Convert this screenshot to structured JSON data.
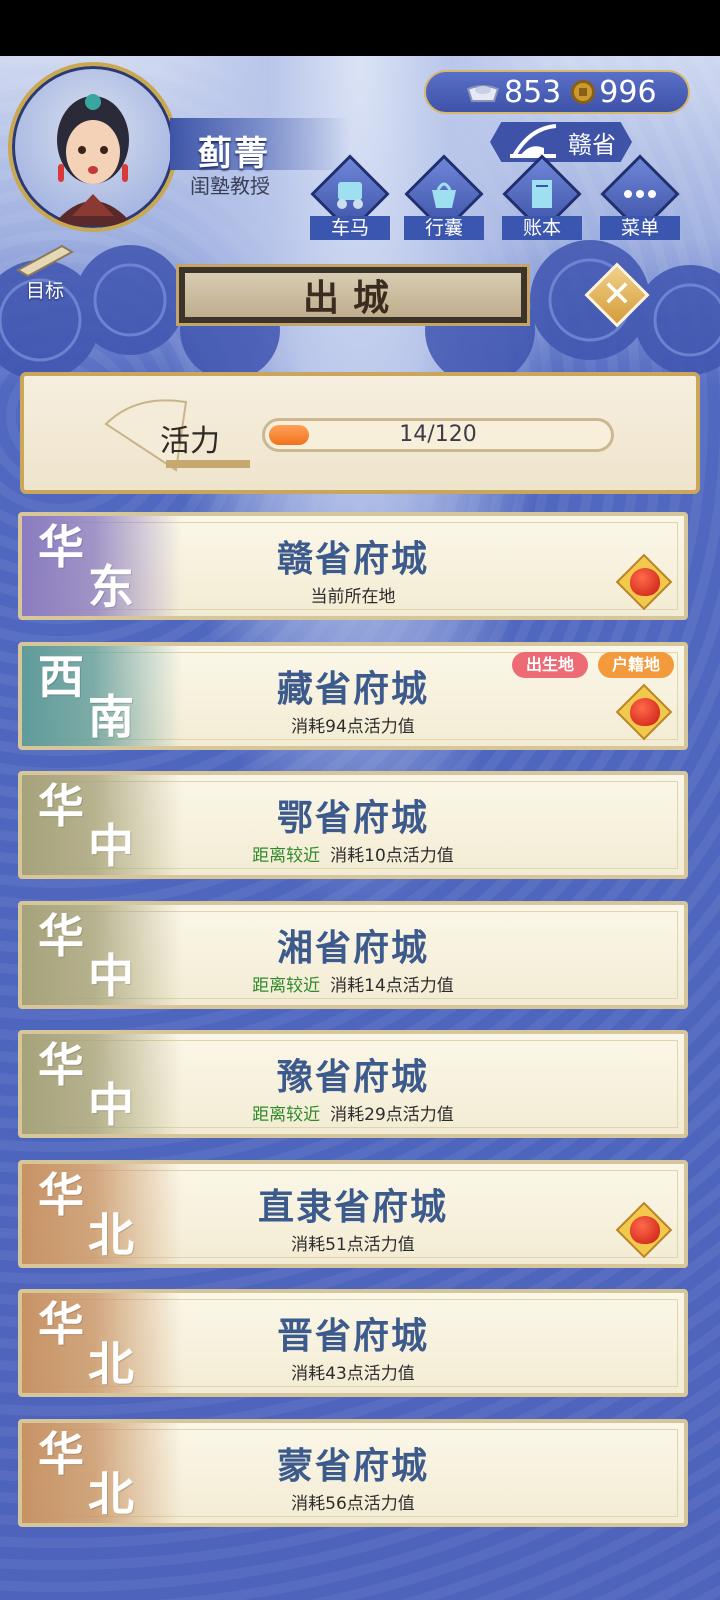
{
  "profile": {
    "name": "蓟菁",
    "title": "闺塾教授"
  },
  "currency": {
    "silver": "853",
    "copper": "996"
  },
  "location": {
    "label": "赣省"
  },
  "nav": [
    {
      "label": "车马",
      "icon": "carriage-icon"
    },
    {
      "label": "行囊",
      "icon": "bag-icon"
    },
    {
      "label": "账本",
      "icon": "ledger-icon"
    },
    {
      "label": "菜单",
      "icon": "menu-dots-icon"
    }
  ],
  "target": {
    "label": "目标"
  },
  "banner": {
    "title": "出城"
  },
  "stamina": {
    "label": "活力",
    "text": "14/120",
    "current": 14,
    "max": 120
  },
  "cities": [
    {
      "region": [
        "华",
        "东"
      ],
      "name": "赣省府城",
      "note": "",
      "sub": "当前所在地",
      "pouch": true,
      "tags": [],
      "tint": "#8a7cc0"
    },
    {
      "region": [
        "西",
        "南"
      ],
      "name": "藏省府城",
      "note": "",
      "sub": "消耗94点活力值",
      "pouch": true,
      "tags": [
        "出生地",
        "户籍地"
      ],
      "tint": "#5f9b9a"
    },
    {
      "region": [
        "华",
        "中"
      ],
      "name": "鄂省府城",
      "note": "距离较近",
      "sub": "消耗10点活力值",
      "pouch": false,
      "tags": [],
      "tint": "#a6a27a"
    },
    {
      "region": [
        "华",
        "中"
      ],
      "name": "湘省府城",
      "note": "距离较近",
      "sub": "消耗14点活力值",
      "pouch": false,
      "tags": [],
      "tint": "#a6a27a"
    },
    {
      "region": [
        "华",
        "中"
      ],
      "name": "豫省府城",
      "note": "距离较近",
      "sub": "消耗29点活力值",
      "pouch": false,
      "tags": [],
      "tint": "#a6a27a"
    },
    {
      "region": [
        "华",
        "北"
      ],
      "name": "直隶省府城",
      "note": "",
      "sub": "消耗51点活力值",
      "pouch": true,
      "tags": [],
      "tint": "#c79365"
    },
    {
      "region": [
        "华",
        "北"
      ],
      "name": "晋省府城",
      "note": "",
      "sub": "消耗43点活力值",
      "pouch": false,
      "tags": [],
      "tint": "#c79365"
    },
    {
      "region": [
        "华",
        "北"
      ],
      "name": "蒙省府城",
      "note": "",
      "sub": "消耗56点活力值",
      "pouch": false,
      "tags": [],
      "tint": "#c79365"
    }
  ]
}
